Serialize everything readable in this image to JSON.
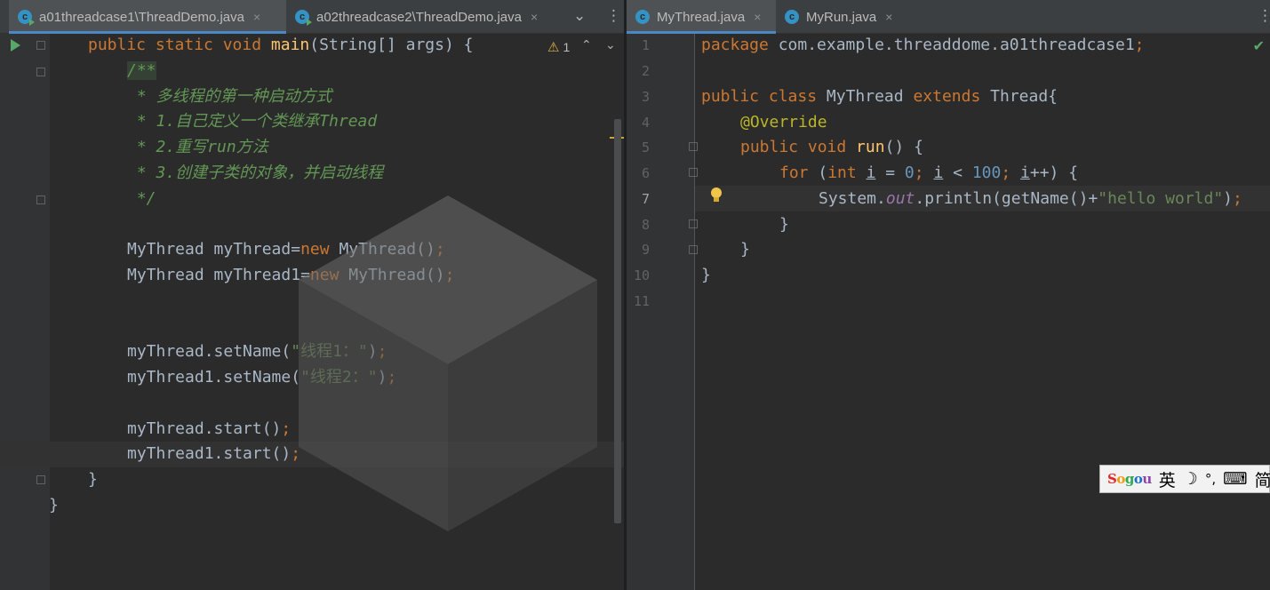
{
  "left_editor": {
    "tabs": [
      {
        "label": "a01threadcase1\\ThreadDemo.java",
        "active": true,
        "close": "×"
      },
      {
        "label": "a02threadcase2\\ThreadDemo.java",
        "active": false,
        "close": "×"
      }
    ],
    "tab_menu_icon": "chevron-down-icon",
    "more_icon": "vertical-dots-icon",
    "warning_count": "1",
    "lines": [
      "public static void main(String[] args) {",
      "/**",
      " * 多线程的第一种启动方式",
      " * 1.自己定义一个类继承Thread",
      " * 2.重写run方法",
      " * 3.创建子类的对象，并启动线程",
      " */",
      "MyThread myThread=new MyThread();",
      "MyThread myThread1=new MyThread();",
      "myThread.setName(\"线程1：\");",
      "myThread1.setName(\"线程2：\");",
      "myThread.start();",
      "myThread1.start();",
      "}",
      "}"
    ]
  },
  "right_editor": {
    "tabs": [
      {
        "label": "MyThread.java",
        "active": true,
        "close": "×"
      },
      {
        "label": "MyRun.java",
        "active": false,
        "close": "×"
      }
    ],
    "line_numbers": [
      "1",
      "2",
      "3",
      "4",
      "5",
      "6",
      "7",
      "8",
      "9",
      "10",
      "11"
    ],
    "current_line": "7",
    "lines": [
      "package com.example.threaddome.a01threadcase1;",
      "",
      "public class MyThread extends Thread{",
      "@Override",
      "public void run() {",
      "for (int i = 0; i < 100; i++) {",
      "System.out.println(getName()+\"hello world\");",
      "}",
      "}",
      "}",
      ""
    ]
  },
  "ime": {
    "logo": "Sogou",
    "mode": "英",
    "moon": "☽",
    "punct": "°,",
    "keyboard": "⌨",
    "charset": "简"
  },
  "colors": {
    "editor_bg": "#2b2b2b",
    "gutter_bg": "#313335",
    "keyword": "#cc7832",
    "string": "#6a8759",
    "number": "#6897bb",
    "doc_comment": "#629755",
    "annotation": "#bbb529",
    "method": "#ffc66d",
    "static_field": "#9876aa",
    "tab_accent": "#4a88c7"
  }
}
